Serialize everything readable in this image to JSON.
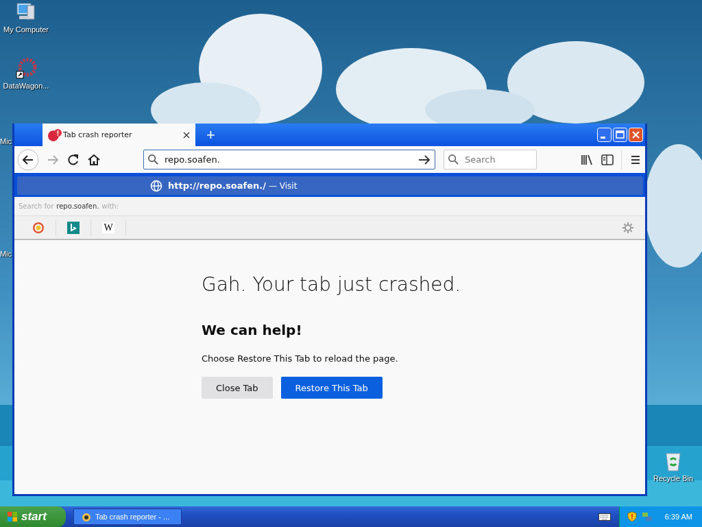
{
  "desktop_icons": [
    {
      "kind": "computer",
      "label": "My Computer"
    },
    {
      "kind": "app",
      "label": "DataWagon..."
    },
    {
      "kind": "partial",
      "label": "Mic"
    },
    {
      "kind": "partial",
      "label": "Mic"
    },
    {
      "kind": "recycle",
      "label": "Recycle Bin"
    }
  ],
  "window": {
    "tab": {
      "title": "Tab crash reporter",
      "selected": true
    },
    "new_tab": "+",
    "url_field": {
      "value": "repo.soafen."
    },
    "search_field": {
      "placeholder": "Search"
    },
    "suggestion": {
      "url": "http://repo.soafen./",
      "action": "— Visit"
    },
    "search_with": {
      "prefix": "Search for",
      "term": "repo.soafen.",
      "suffix": "with:"
    },
    "engines": [
      {
        "kind": "duckduckgo"
      },
      {
        "kind": "bing"
      },
      {
        "kind": "wikipedia",
        "glyph": "W"
      }
    ]
  },
  "page": {
    "heading": "Gah. Your tab just crashed.",
    "subheading": "We can help!",
    "message": "Choose Restore This Tab to reload the page.",
    "buttons": [
      {
        "label": "Close Tab",
        "kind": "secondary"
      },
      {
        "label": "Restore This Tab",
        "kind": "primary"
      }
    ]
  },
  "taskbar": {
    "start": "start",
    "tasks": [
      {
        "label": "Tab crash reporter - ..."
      }
    ],
    "clock": "6:39 AM"
  }
}
